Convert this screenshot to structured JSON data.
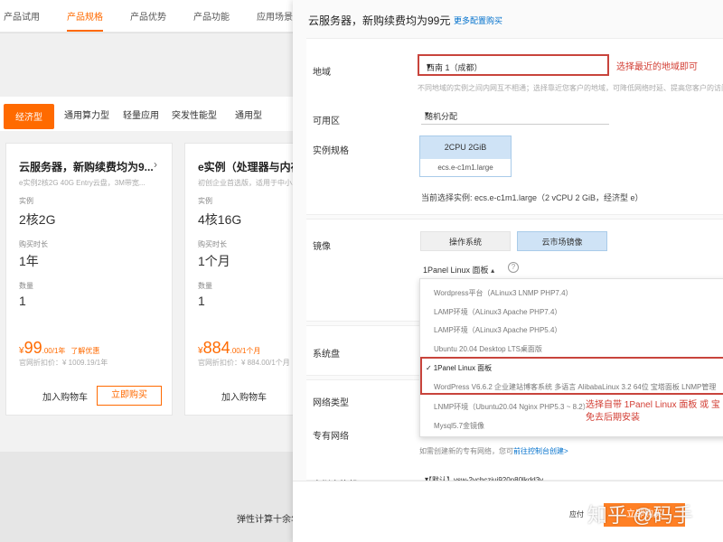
{
  "nav": {
    "items": [
      "产品试用",
      "产品规格",
      "产品优势",
      "产品功能",
      "应用场景"
    ],
    "active_index": 1
  },
  "subtabs": {
    "items": [
      "经济型",
      "通用算力型",
      "轻量应用",
      "突发性能型",
      "通用型"
    ],
    "active_index": 0
  },
  "cards": [
    {
      "title": "云服务器，新购续费均为9...",
      "desc": "e实例2核2G 40G Entry云盘，3M带宽...",
      "instance_label": "实例",
      "instance_value": "2核2G",
      "duration_label": "购买时长",
      "duration_value": "1年",
      "qty_label": "数量",
      "qty_value": "1",
      "price_currency": "¥",
      "price_value": "99",
      "price_unit": ".00/1年",
      "badge": "了解优惠",
      "orig_price": "官网折扣价：¥ 1009.19/1年",
      "cart_label": "加入购物车",
      "buy_label": "立即购买"
    },
    {
      "title": "e实例（处理器与内存比...",
      "desc": "初创企业首选版，适用于中小...",
      "instance_label": "实例",
      "instance_value": "4核16G",
      "duration_label": "购买时长",
      "duration_value": "1个月",
      "qty_label": "数量",
      "qty_value": "1",
      "price_currency": "¥",
      "price_value": "884",
      "price_unit": ".00/1个月",
      "badge": "",
      "orig_price": "官网折扣价：¥ 884.00/1个月",
      "cart_label": "加入购物车",
      "buy_label": ""
    }
  ],
  "footer_text": "弹性计算十余年",
  "panel": {
    "title": "云服务器，新购续费均为99元",
    "more_link": "更多配置购买",
    "region": {
      "label": "地域",
      "value": "西南 1（成都）",
      "note": "选择最近的地域即可",
      "hint": "不同地域的实例之间内网互不相通；选择靠近您客户的地域，可降低网络时延、提高您客户的访问速度"
    },
    "zone": {
      "label": "可用区",
      "value": "随机分配"
    },
    "spec": {
      "label": "实例规格",
      "card_top": "2CPU 2GiB",
      "card_bottom": "ecs.e-c1m1.large",
      "current": "当前选择实例: ecs.e-c1m1.large（2 vCPU 2 GiB，经济型 e）"
    },
    "image": {
      "label": "镜像",
      "tabs": [
        "操作系统",
        "云市场镜像"
      ],
      "selected": "1Panel Linux 面板",
      "help": "?",
      "options": [
        "Wordpress平台（ALinux3 LNMP PHP7.4）",
        "LAMP环境（ALinux3 Apache PHP7.4）",
        "LAMP环境（ALinux3 Apache PHP5.4）",
        "Ubuntu 20.04 Desktop LTS桌面版",
        "1Panel Linux 面板",
        "WordPress V6.6.2 企业建站博客系统 多语言 AlibabaLinux 3.2 64位 宝塔面板 LNMP管理",
        "LNMP环境（Ubuntu20.04 Nginx PHP5.3 ~ 8.2）",
        "Mysql5.7金镜像"
      ],
      "selected_index": 4,
      "note_line1": "选择自带 1Panel Linux 面板 或 宝",
      "note_line2": "免去后期安装"
    },
    "disk_label": "系统盘",
    "network_label": "网络类型",
    "vpc": {
      "label": "专有网络",
      "hint_prefix": "如需创建新的专有网络，您可",
      "hint_link": "前往控制台创建>"
    },
    "vswitch": {
      "label": "虚拟交换机",
      "value": "【默认】vsw-2vcbczjuj920n80lkdd3v"
    },
    "fee_label": "应付",
    "confirm_label": "立即购买"
  },
  "watermark": "知乎 @码手"
}
